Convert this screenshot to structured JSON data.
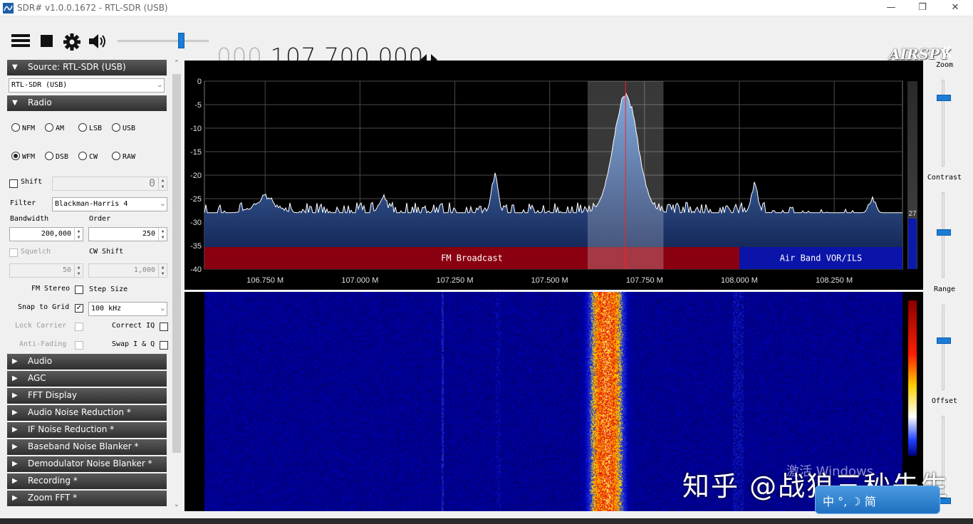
{
  "window": {
    "title": "SDR# v1.0.0.1672 - RTL-SDR (USB)",
    "minimize": "—",
    "maximize": "❐",
    "close": "✕"
  },
  "toolbar": {
    "menu_icon": "hamburger-icon",
    "stop_icon": "stop-icon",
    "settings_icon": "gear-icon",
    "audio_icon": "speaker-icon",
    "volume_level": 0.72,
    "freq_dim": "000.",
    "freq_bright": "107.700.000",
    "tune_icon": "left-right-arrows-icon",
    "logo": "AIRSPY"
  },
  "left": {
    "source_header": "Source: RTL-SDR (USB)",
    "source_combo": "RTL-SDR (USB)",
    "radio_header": "Radio",
    "modes_row1": [
      "NFM",
      "AM",
      "LSB",
      "USB"
    ],
    "modes_row2": [
      "WFM",
      "DSB",
      "CW",
      "RAW"
    ],
    "selected_mode": "WFM",
    "shift_label": "Shift",
    "shift_value": "0",
    "filter_label": "Filter",
    "filter_value": "Blackman-Harris 4",
    "bandwidth_label": "Bandwidth",
    "bandwidth_value": "200,000",
    "order_label": "Order",
    "order_value": "250",
    "squelch_label": "Squelch",
    "squelch_value": "50",
    "cwshift_label": "CW Shift",
    "cwshift_value": "1,000",
    "fm_stereo_label": "FM Stereo",
    "step_size_label": "Step Size",
    "snap_label": "Snap to Grid",
    "step_value": "100 kHz",
    "lock_carrier_label": "Lock Carrier",
    "correct_iq_label": "Correct IQ",
    "anti_fading_label": "Anti-Fading",
    "swap_iq_label": "Swap I & Q",
    "collapsed": [
      "Audio",
      "AGC",
      "FFT Display",
      "Audio Noise Reduction *",
      "IF Noise Reduction *",
      "Baseband Noise Blanker *",
      "Demodulator Noise Blanker *",
      "Recording *",
      "Zoom FFT *"
    ]
  },
  "right": {
    "zoom_label": "Zoom",
    "contrast_label": "Contrast",
    "range_label": "Range",
    "offset_label": "Offset",
    "zoom_level": 0.82,
    "contrast_level": 0.55,
    "range_level": 0.6,
    "offset_level": 0.0
  },
  "spectrum": {
    "y_ticks": [
      "0",
      "-5",
      "-10",
      "-15",
      "-20",
      "-25",
      "-30",
      "-35",
      "-40"
    ],
    "x_ticks": [
      "106.750 M",
      "107.000 M",
      "107.250 M",
      "107.500 M",
      "107.750 M",
      "108.000 M",
      "108.250 M"
    ],
    "band1": "FM Broadcast",
    "band2": "Air Band VOR/ILS",
    "level_value": "27",
    "colors": {
      "band1": "#8b0010",
      "band2": "#0a14a8",
      "trace": "#ffffff",
      "fill_top": "#5c8fcf",
      "fill_bottom": "#0b1a4a"
    }
  },
  "overlay": {
    "watermark": "知乎 @战狼三秒先生",
    "activate": "激活 Windows",
    "ime": "中 °, ☽ 简"
  }
}
